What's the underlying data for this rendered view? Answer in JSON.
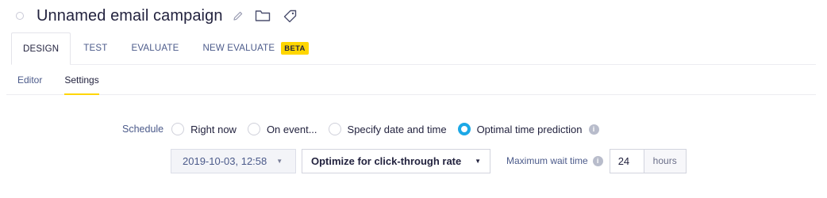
{
  "campaign": {
    "title": "Unnamed email campaign"
  },
  "icons": {
    "status": "status-dot-icon",
    "edit": "pencil-icon",
    "folder": "folder-icon",
    "tag": "tag-icon",
    "info": "info-icon"
  },
  "tabs": [
    {
      "label": "DESIGN",
      "active": true
    },
    {
      "label": "TEST",
      "active": false
    },
    {
      "label": "EVALUATE",
      "active": false
    },
    {
      "label": "NEW EVALUATE",
      "active": false,
      "badge": "BETA"
    }
  ],
  "subtabs": [
    {
      "label": "Editor",
      "active": false
    },
    {
      "label": "Settings",
      "active": true
    }
  ],
  "schedule": {
    "label": "Schedule",
    "options": [
      {
        "label": "Right now",
        "checked": false
      },
      {
        "label": "On event...",
        "checked": false
      },
      {
        "label": "Specify date and time",
        "checked": false
      },
      {
        "label": "Optimal time prediction",
        "checked": true
      }
    ]
  },
  "prediction": {
    "date_value": "2019-10-03, 12:58",
    "optimize_value": "Optimize for click-through rate",
    "max_wait_label": "Maximum wait time",
    "max_wait_value": "24",
    "max_wait_unit": "hours"
  },
  "colors": {
    "accent_yellow": "#ffd600",
    "radio_selected": "#1ca8e6",
    "link_blue": "#4b5a8a"
  }
}
